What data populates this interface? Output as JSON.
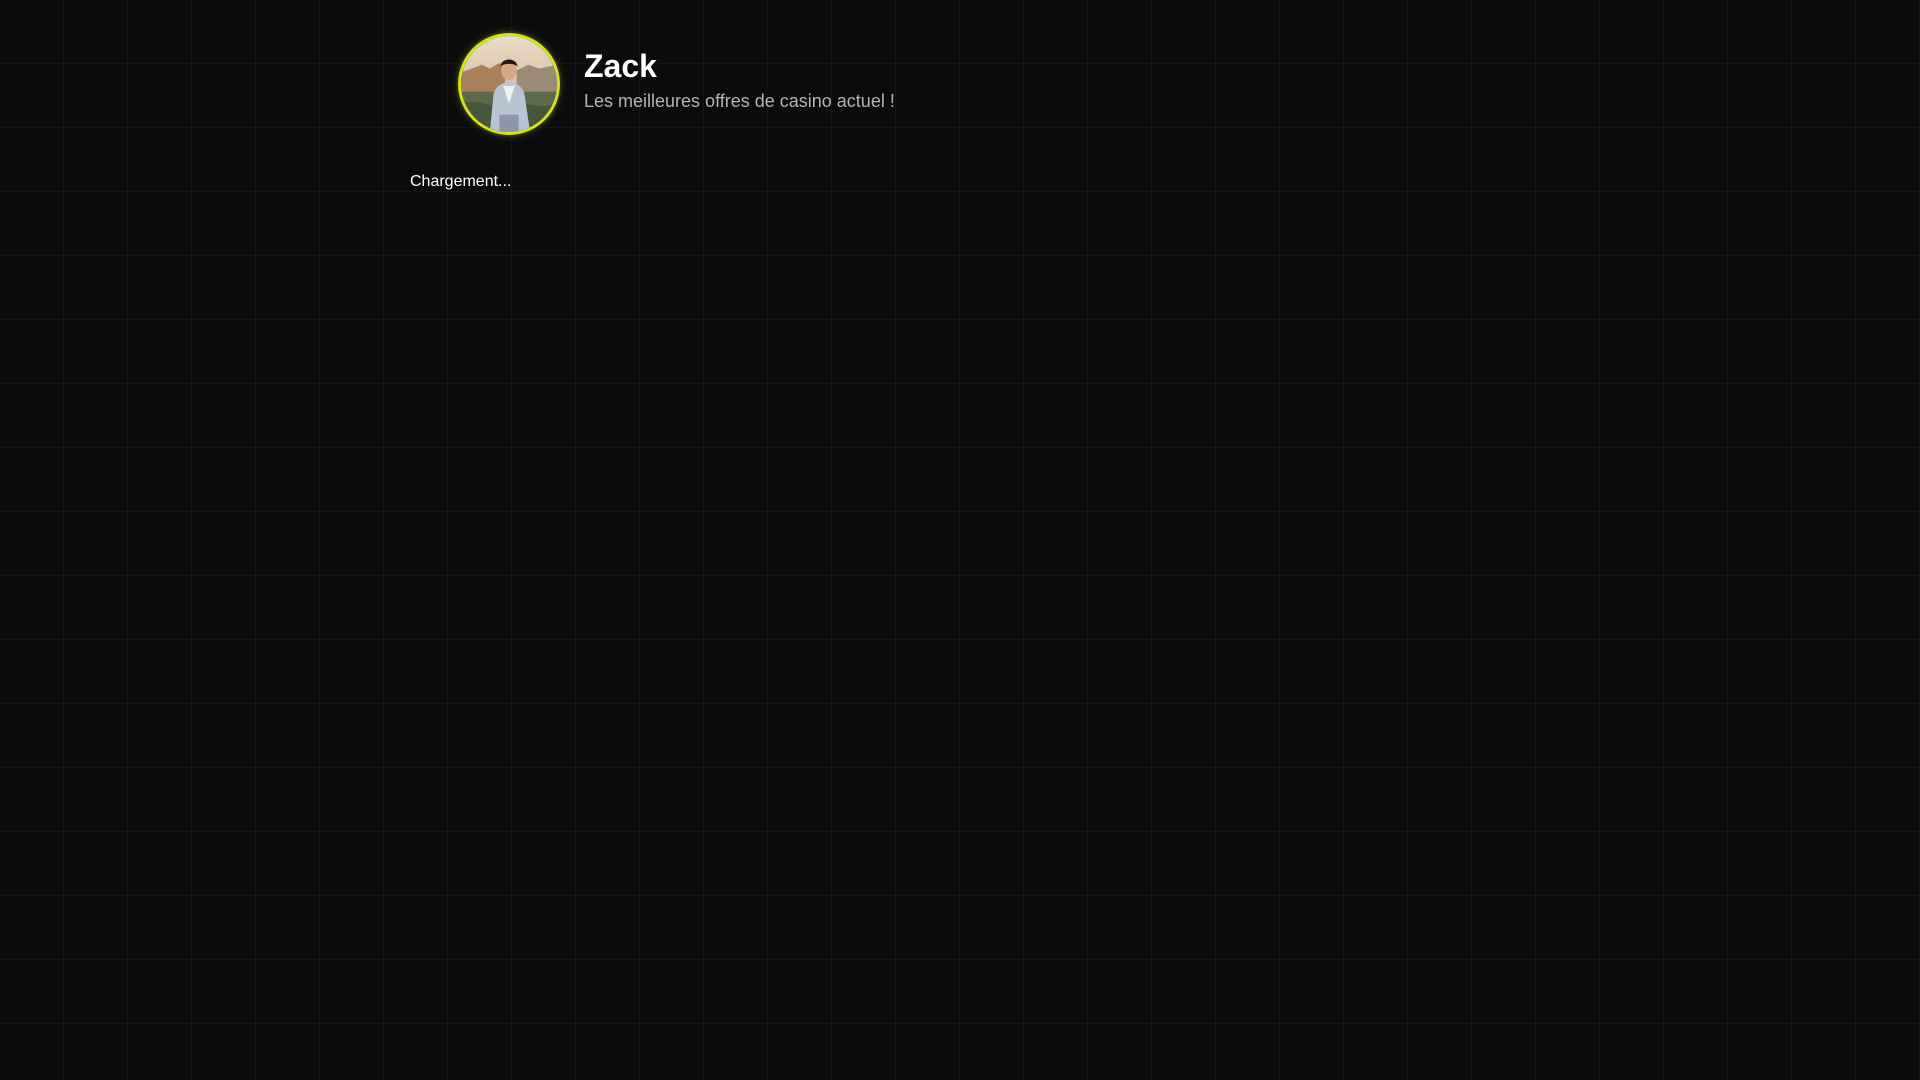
{
  "profile": {
    "name": "Zack",
    "tagline": "Les meilleures offres de casino actuel !",
    "avatar_icon": "person-photo-icon"
  },
  "status": {
    "loading_text": "Chargement..."
  },
  "colors": {
    "background": "#0b0b0c",
    "accent": "#d4e21a",
    "text_primary": "#ffffff",
    "text_secondary": "#b4b4b8"
  }
}
